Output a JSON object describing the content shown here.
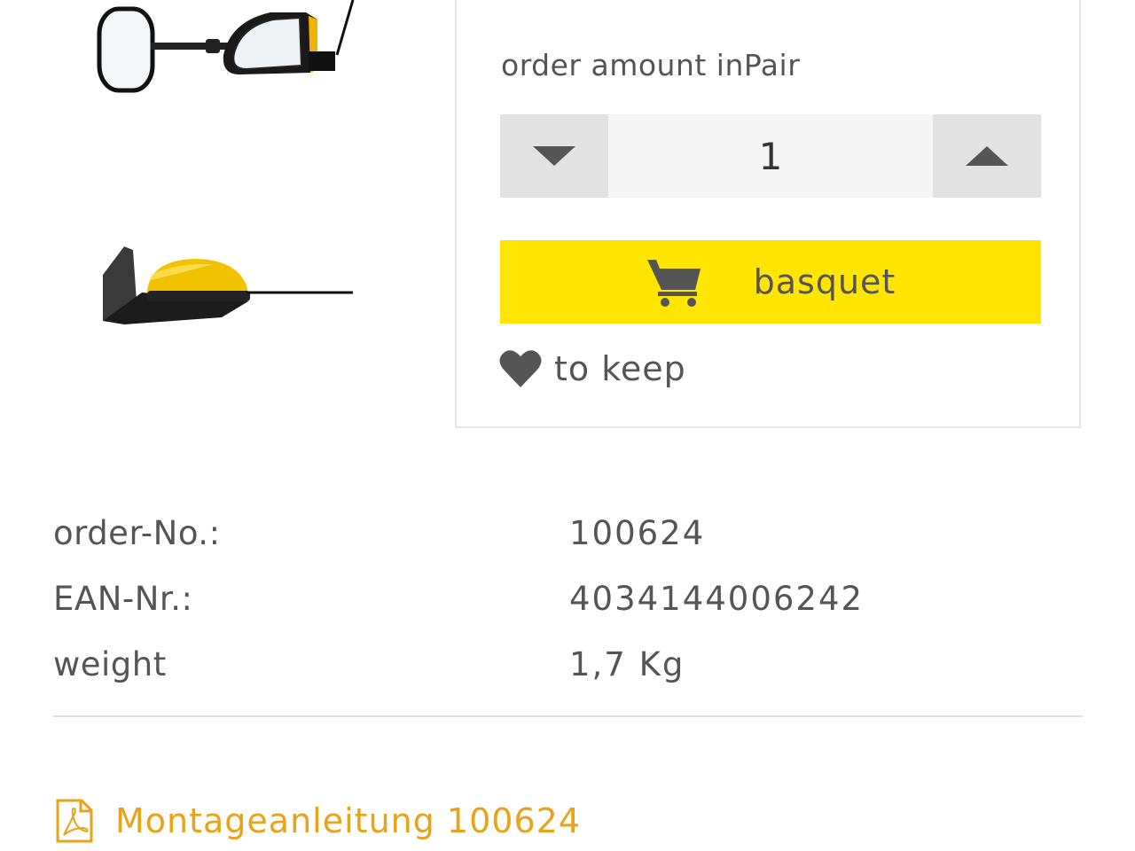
{
  "product": {
    "images": [
      "mirror-front-view",
      "mirror-side-view"
    ]
  },
  "purchase": {
    "amount_label": "order amount inPair",
    "quantity": "1",
    "basket_label": "basquet",
    "keep_label": "to keep"
  },
  "specs": [
    {
      "label": "order-No.:",
      "value": "100624"
    },
    {
      "label": "EAN-Nr.:",
      "value": "4034144006242"
    },
    {
      "label": "weight",
      "value": "1,7 Kg"
    }
  ],
  "downloads": {
    "manual_label": "Montageanleitung 100624",
    "icon": "pdf-icon"
  },
  "colors": {
    "accent_yellow": "#ffe500",
    "link_orange": "#e8a319",
    "text": "#555555"
  }
}
